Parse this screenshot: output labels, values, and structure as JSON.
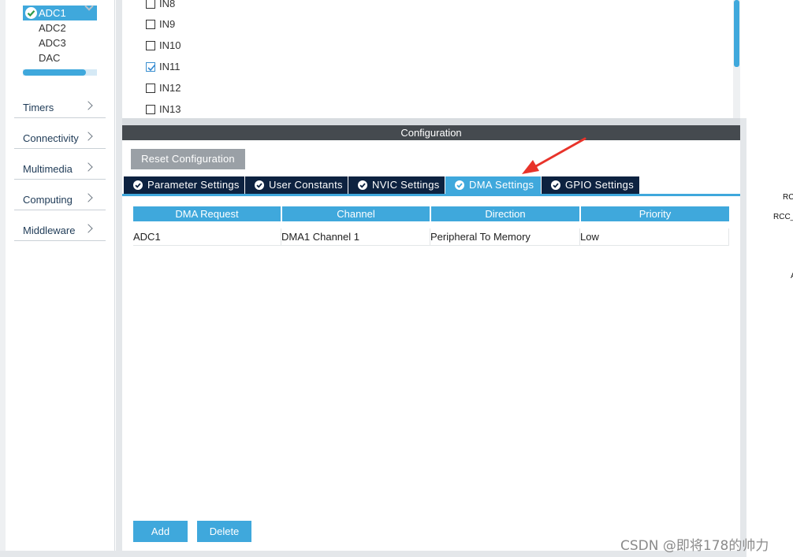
{
  "sidebar": {
    "analog_items": [
      {
        "label": "ADC1",
        "selected": true
      },
      {
        "label": "ADC2",
        "selected": false
      },
      {
        "label": "ADC3",
        "selected": false
      },
      {
        "label": "DAC",
        "selected": false
      }
    ],
    "scroll_progress": 0.85,
    "categories": [
      {
        "label": "Timers"
      },
      {
        "label": "Connectivity"
      },
      {
        "label": "Multimedia"
      },
      {
        "label": "Computing"
      },
      {
        "label": "Middleware"
      }
    ]
  },
  "channels": [
    {
      "label": "IN8",
      "checked": false
    },
    {
      "label": "IN9",
      "checked": false
    },
    {
      "label": "IN10",
      "checked": false
    },
    {
      "label": "IN11",
      "checked": true
    },
    {
      "label": "IN12",
      "checked": false
    },
    {
      "label": "IN13",
      "checked": false
    }
  ],
  "configuration": {
    "title": "Configuration",
    "reset_label": "Reset Configuration",
    "tabs": [
      {
        "label": "Parameter Settings",
        "active": false
      },
      {
        "label": "User Constants",
        "active": false
      },
      {
        "label": "NVIC Settings",
        "active": false
      },
      {
        "label": "DMA Settings",
        "active": true
      },
      {
        "label": "GPIO Settings",
        "active": false
      }
    ],
    "dma_table": {
      "headers": [
        "DMA Request",
        "Channel",
        "Direction",
        "Priority"
      ],
      "rows": [
        [
          "ADC1",
          "DMA1 Channel 1",
          "Peripheral To Memory",
          "Low"
        ]
      ]
    },
    "add_label": "Add",
    "delete_label": "Delete"
  },
  "right_pane": {
    "pin_labels": [
      "RC",
      "RCC_",
      "A"
    ]
  },
  "watermark": "CSDN @即将178的帅力",
  "colors": {
    "accent": "#3fa8dc",
    "tab_dark": "#0d2240",
    "header_bar": "#454a4f",
    "annotation_arrow": "#e8332a"
  }
}
